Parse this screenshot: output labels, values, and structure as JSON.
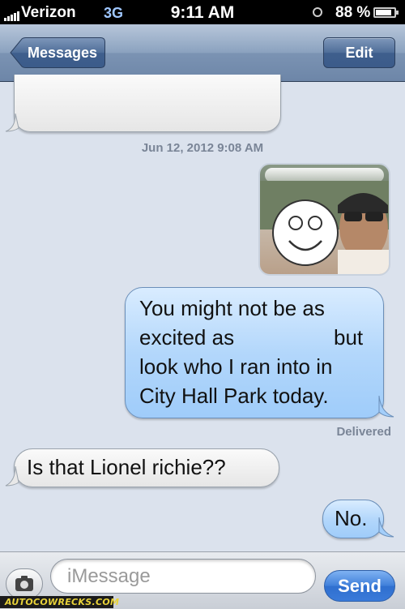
{
  "status_bar": {
    "carrier": "Verizon",
    "network": "3G",
    "time": "9:11 AM",
    "battery_percent": "88 %",
    "battery_level": 0.88
  },
  "navbar": {
    "back_label": "Messages",
    "edit_label": "Edit"
  },
  "thread": {
    "timestamp": "Jun 12, 2012 9:08 AM",
    "sent_message_line1": "You might not be as",
    "sent_message_line2a": "excited as",
    "sent_message_line2b": "but",
    "sent_message_line3": "look who I ran into in",
    "sent_message_line4": "City Hall Park today.",
    "delivered_label": "Delivered",
    "received_message": "Is that Lionel richie??",
    "sent_reply": "No."
  },
  "composer": {
    "placeholder": "iMessage",
    "send_label": "Send"
  },
  "watermark": {
    "text": "AUTOCOWRECKS.COM"
  },
  "colors": {
    "background": "#dbe2ed",
    "sent_bubble": "#b3d7fb",
    "received_bubble": "#f0f0f0",
    "send_button": "#3f7fda"
  }
}
